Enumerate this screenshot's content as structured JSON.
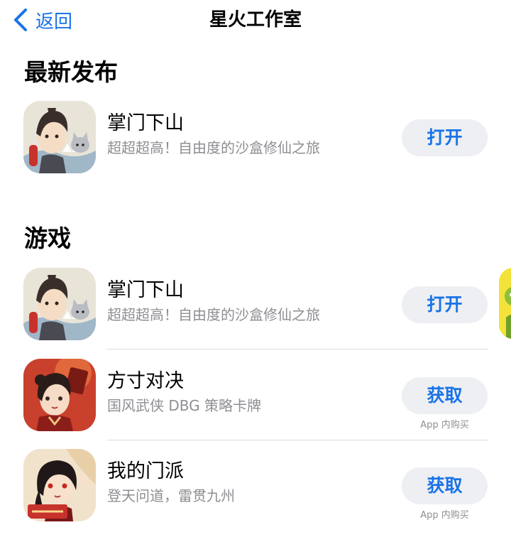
{
  "nav": {
    "back_label": "返回",
    "title": "星火工作室",
    "accent_color": "#1a73e8"
  },
  "sections": {
    "latest": {
      "title": "最新发布",
      "apps": [
        {
          "name": "掌门下山",
          "subtitle": "超超超高！自由度的沙盒修仙之旅",
          "action": "打开",
          "icon": "zhangmen-xiashan-app-icon"
        }
      ]
    },
    "games": {
      "title": "游戏",
      "apps": [
        {
          "name": "掌门下山",
          "subtitle": "超超超高！自由度的沙盒修仙之旅",
          "action": "打开",
          "icon": "zhangmen-xiashan-app-icon"
        },
        {
          "name": "方寸对决",
          "subtitle": "国风武侠 DBG 策略卡牌",
          "action": "获取",
          "note": "App 内购买",
          "icon": "fangcun-duijue-app-icon"
        },
        {
          "name": "我的门派",
          "subtitle": "登天问道，雷贯九州",
          "action": "获取",
          "note": "App 内购买",
          "icon": "wode-menpai-app-icon"
        }
      ]
    }
  }
}
